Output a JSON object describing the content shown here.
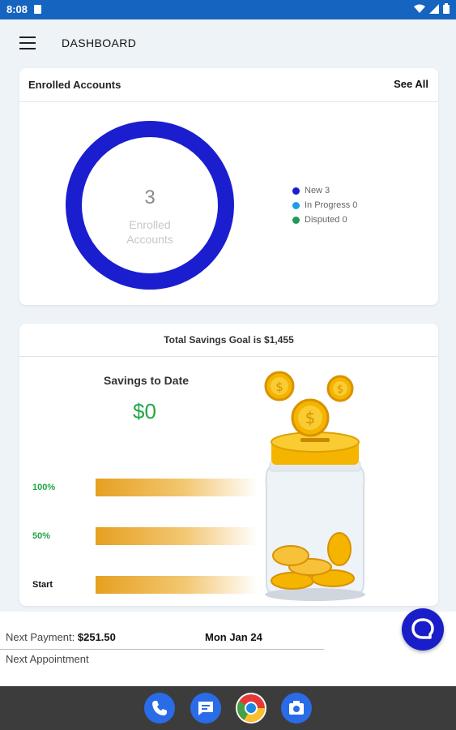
{
  "status_bar": {
    "time": "8:08",
    "icons": [
      "sd-card-icon",
      "wifi-icon",
      "cell-signal-icon",
      "battery-icon"
    ]
  },
  "app_bar": {
    "title": "DASHBOARD"
  },
  "enrolled_accounts": {
    "title": "Enrolled Accounts",
    "see_all_label": "See All",
    "total_count": "3",
    "center_label_line1": "Enrolled",
    "center_label_line2": "Accounts",
    "legend": [
      {
        "label": "New 3",
        "color": "#1a1ecf"
      },
      {
        "label": "In Progress 0",
        "color": "#1e9ee8"
      },
      {
        "label": "Disputed 0",
        "color": "#1e9a5a"
      }
    ],
    "donut_color": "#1a1ecf"
  },
  "savings": {
    "goal_text": "Total Savings Goal is $1,455",
    "to_date_label": "Savings to Date",
    "to_date_amount": "$0",
    "progress_fraction": 0,
    "milestones": [
      {
        "label": "100%",
        "color": "#22a745"
      },
      {
        "label": "50%",
        "color": "#22a745"
      },
      {
        "label": "Start",
        "color": "#111111"
      }
    ],
    "amount_color": "#22a745",
    "bar_color": "#e6a020"
  },
  "next_info": {
    "payment_label": "Next Payment:",
    "payment_amount": "$251.50",
    "payment_date": "Mon Jan 24",
    "appointment_label": "Next Appointment"
  },
  "chat": {
    "icon": "chat-bubble-icon",
    "color": "#1a1ec8"
  },
  "dock": {
    "apps": [
      {
        "name": "phone-icon",
        "color": "#2a6ce8"
      },
      {
        "name": "messages-icon",
        "color": "#2a6ce8"
      },
      {
        "name": "chrome-icon",
        "color": "#e53935"
      },
      {
        "name": "camera-icon",
        "color": "#2a6ce8"
      }
    ]
  },
  "accent_color": "#1565c0"
}
